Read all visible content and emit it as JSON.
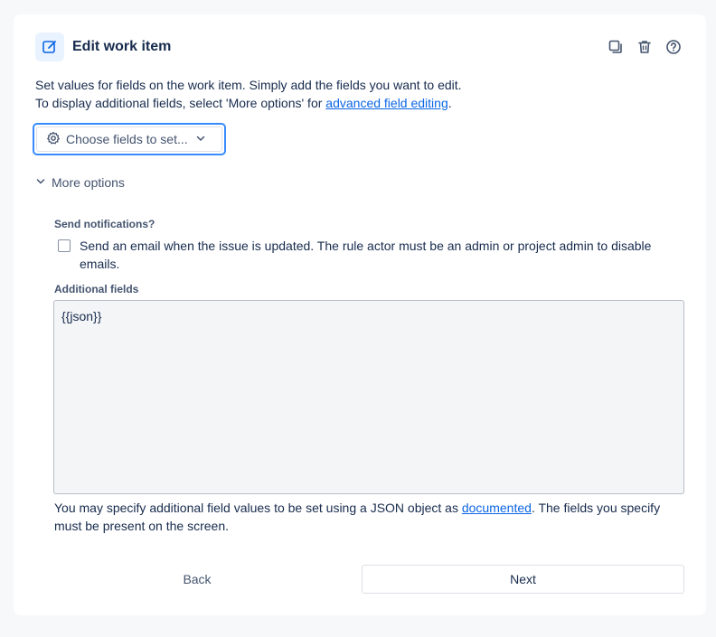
{
  "header": {
    "title": "Edit work item",
    "icon": "edit-icon",
    "actions": [
      "duplicate-icon",
      "trash-icon",
      "help-icon"
    ]
  },
  "description": {
    "line1": "Set values for fields on the work item. Simply add the fields you want to edit.",
    "line2_prefix": "To display additional fields, select 'More options' for ",
    "line2_link": "advanced field editing",
    "line2_suffix": "."
  },
  "choose_fields": {
    "label": "Choose fields to set...",
    "icon": "gear-icon"
  },
  "more_options": {
    "label": "More options"
  },
  "notifications": {
    "label": "Send notifications?",
    "checkbox_text": "Send an email when the issue is updated. The rule actor must be an admin or project admin to disable emails.",
    "checked": false
  },
  "additional_fields": {
    "label": "Additional fields",
    "value": "{{json}}",
    "help_prefix": "You may specify additional field values to be set using a JSON object as ",
    "help_link": "documented",
    "help_suffix": ". The fields you specify must be present on the screen."
  },
  "footer": {
    "back_label": "Back",
    "next_label": "Next"
  },
  "colors": {
    "accent": "#388bff",
    "link": "#0c66e4",
    "icon_bg": "#e9f2ff"
  }
}
